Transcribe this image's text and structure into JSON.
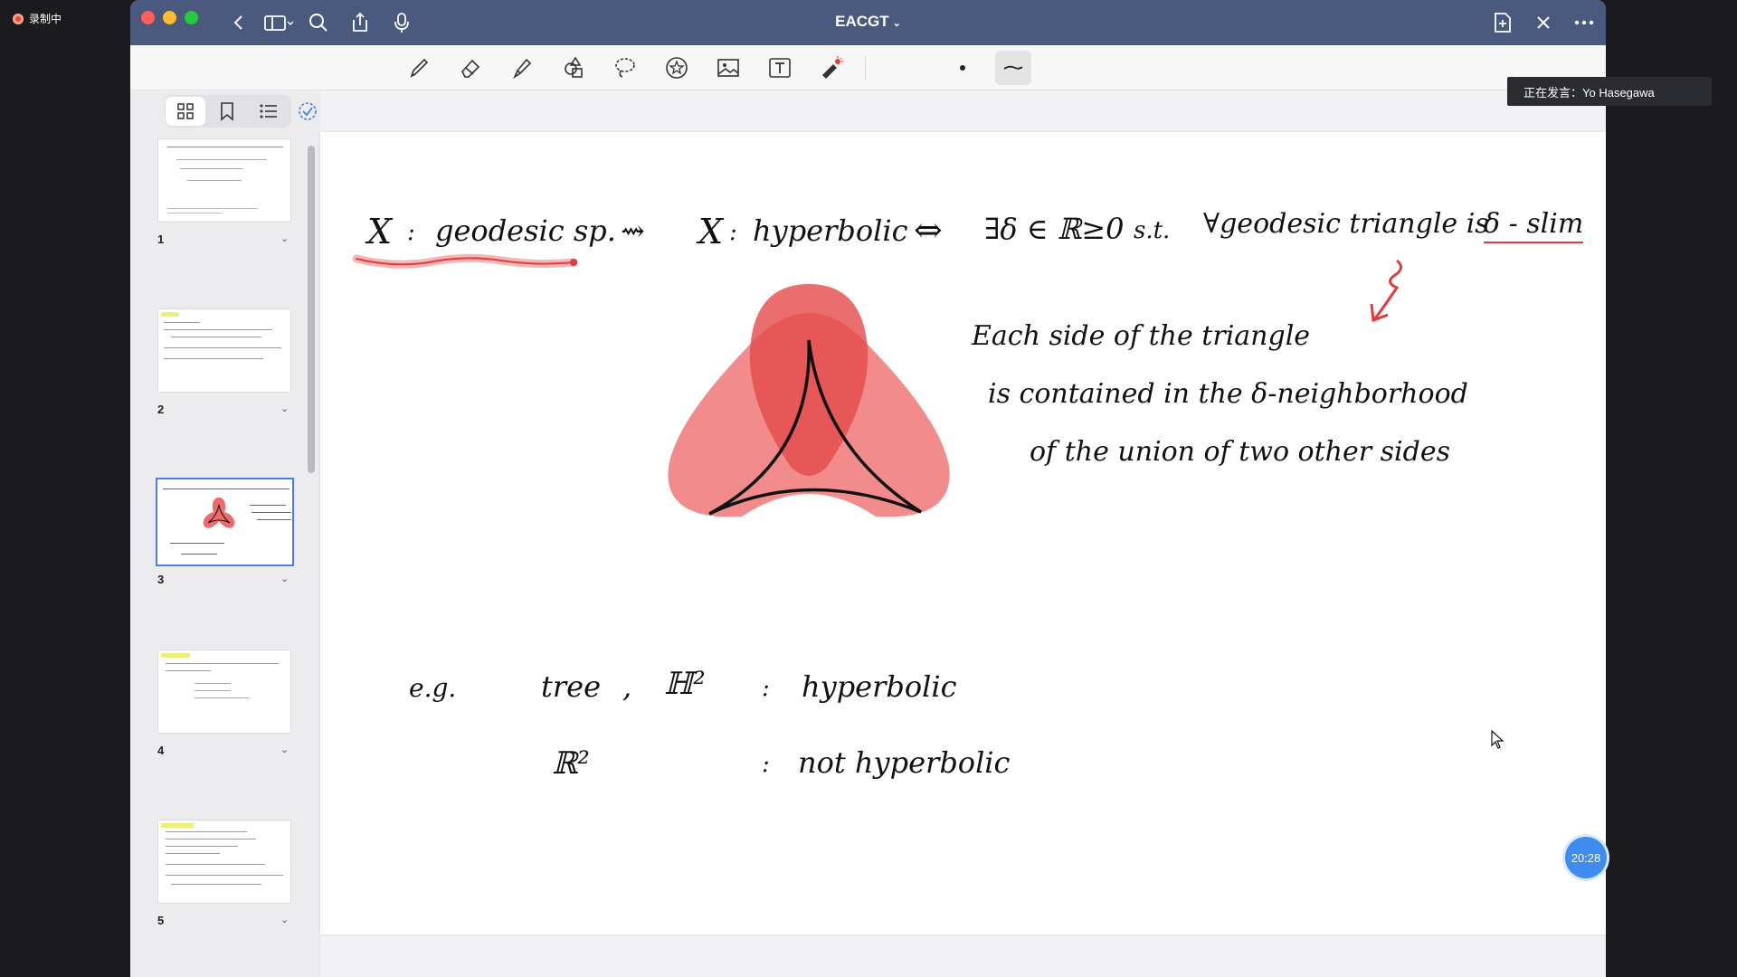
{
  "recording": {
    "label": "录制中"
  },
  "window": {
    "title": "EACGT"
  },
  "titlebar_icons": [
    "back-icon",
    "sidebar-toggle-icon",
    "search-icon",
    "share-icon",
    "microphone-icon",
    "new-page-icon",
    "close-icon",
    "more-icon"
  ],
  "toolbar": {
    "tools": [
      "pen-icon",
      "eraser-icon",
      "highlighter-icon",
      "shapes-icon",
      "lasso-icon",
      "sticker-icon",
      "image-icon",
      "text-icon",
      "laser-pointer-icon"
    ]
  },
  "sidebar": {
    "tabs": [
      "thumbnails-icon",
      "bookmarks-icon",
      "outline-icon"
    ],
    "pages": [
      {
        "number": "1"
      },
      {
        "number": "2"
      },
      {
        "number": "3"
      },
      {
        "number": "4"
      },
      {
        "number": "5"
      }
    ],
    "active_page": "3"
  },
  "note": {
    "line1": {
      "x": "X",
      "colon": ":",
      "geodesic_sp": "geodesic sp.",
      "arrow": "⇝",
      "x2": "X",
      "colon2": ":",
      "hyperbolic": "hyperbolic",
      "iff": "⇔",
      "exists": "∃δ ∈ ℝ≥0",
      "st": "s.t.",
      "forall": "∀geodesic triangle is",
      "slim": "δ - slim"
    },
    "explain": [
      "Each side of the triangle",
      "is contained in the δ-neighborhood",
      "of the union of two other sides"
    ],
    "examples": {
      "eg": "e.g.",
      "tree": "tree",
      "comma": ",",
      "h2": "ℍ²",
      "colon": ":",
      "hyperbolic": "hyperbolic",
      "r2": "ℝ²",
      "colon2": ":",
      "not_hyperbolic": "not hyperbolic"
    }
  },
  "speaker": {
    "label": "正在发言：Yo Hasegawa"
  },
  "timer": {
    "value": "20:28"
  },
  "colors": {
    "titlebar": "#4a5a7e",
    "accent": "#4c7ee6",
    "red_ink": "#e23b3b",
    "triangle_fill": "#ee6b6b"
  }
}
